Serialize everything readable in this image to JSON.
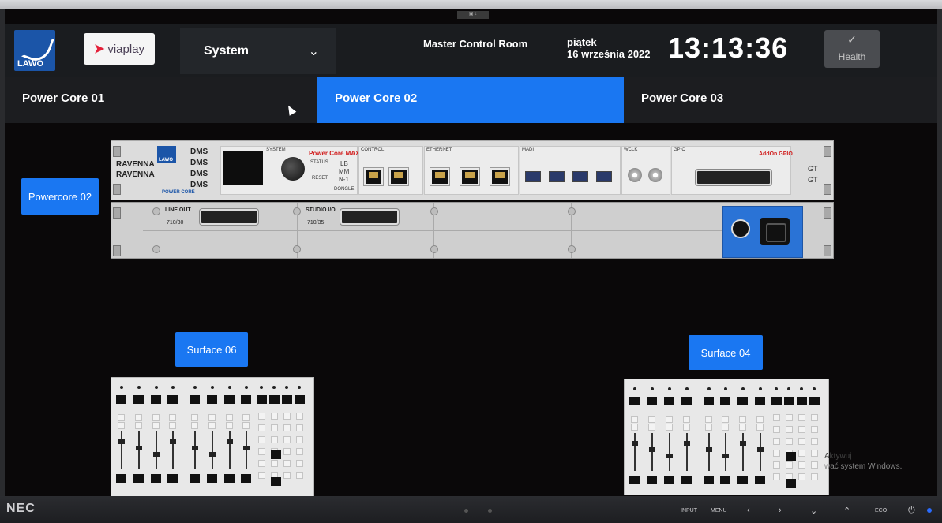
{
  "header": {
    "logo_text": "LAWO",
    "brand_name": "viaplay",
    "system_dropdown": "System",
    "room": "Master Control Room",
    "day": "piątek",
    "date": "16 września 2022",
    "time": "13:13:36",
    "health_label": "Health"
  },
  "tabs": [
    {
      "label": "Power Core 01",
      "active": false
    },
    {
      "label": "Power Core 02",
      "active": true
    },
    {
      "label": "Power Core 03",
      "active": false
    }
  ],
  "device": {
    "button_label": "Powercore 02",
    "front_text": {
      "ravenna1": "RAVENNA",
      "ravenna2": "RAVENNA",
      "dms": [
        "DMS",
        "DMS",
        "DMS",
        "DMS"
      ],
      "system": "SYSTEM",
      "model": "Power Core MAX",
      "status": "STATUS",
      "reset": "RESET",
      "lb": "LB",
      "mm": "MM",
      "n1": "N-1",
      "dongle": "DONGLE",
      "control": "CONTROL",
      "ethernet": "ETHERNET",
      "madi": "MADI",
      "wclk": "WCLK",
      "gpio": "GPIO",
      "addon": "AddOn GPIO",
      "gt1": "GT",
      "gt2": "GT",
      "power_core": "POWER CORE"
    },
    "cards": [
      {
        "name": "LINE OUT",
        "model": "710/30"
      },
      {
        "name": "STUDIO I/O",
        "model": "710/35"
      }
    ]
  },
  "surfaces": [
    {
      "label": "Surface 06"
    },
    {
      "label": "Surface 04"
    }
  ],
  "watermark": {
    "line1": "Aktywuj",
    "line2": "wać system Windows."
  },
  "monitor": {
    "brand": "NEC",
    "buttons": [
      "INPUT",
      "MENU",
      "ECO"
    ]
  },
  "colors": {
    "accent": "#1a77f2",
    "background": "#0a0809",
    "bar": "#1c1d20"
  }
}
